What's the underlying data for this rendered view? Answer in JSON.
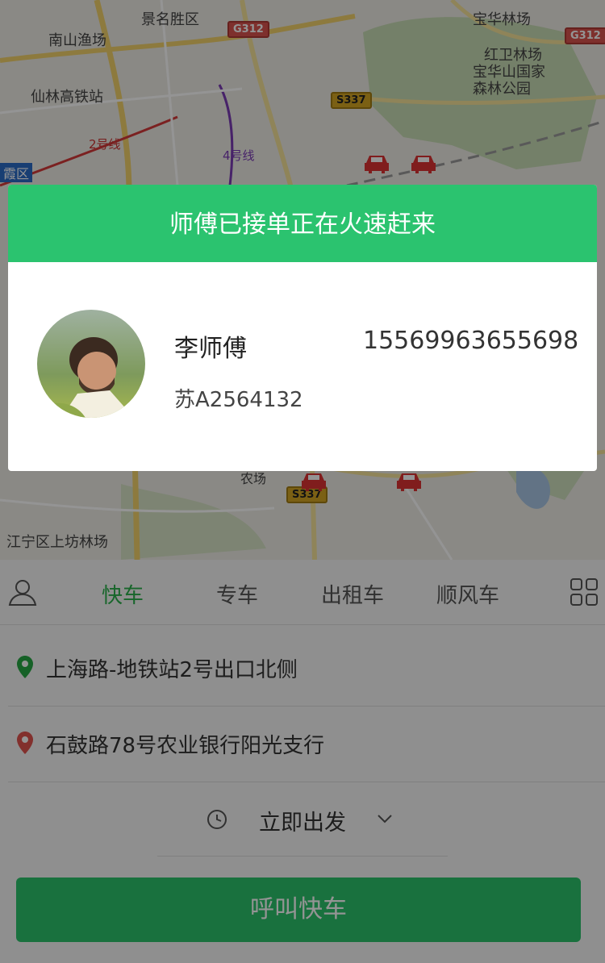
{
  "map": {
    "labels": [
      "南山渔场",
      "仙林高铁站",
      "景名胜区",
      "宝华林场",
      "红卫林场",
      "宝华山国家",
      "森林公园",
      "2号线",
      "4号线",
      "江宁区上坊林场",
      "农场",
      "霞区"
    ],
    "roads": [
      "G312",
      "G312",
      "S337",
      "S337"
    ]
  },
  "tabs": {
    "profile_icon": "person-icon",
    "items": [
      {
        "label": "快车",
        "active": true
      },
      {
        "label": "专车",
        "active": false
      },
      {
        "label": "出租车",
        "active": false
      },
      {
        "label": "顺风车",
        "active": false
      }
    ],
    "more_icon": "grid-icon"
  },
  "route": {
    "start": "上海路-地铁站2号出口北侧",
    "destination": "石鼓路78号农业银行阳光支行",
    "start_color": "#27a844",
    "destination_color": "#e0534e"
  },
  "departure": {
    "label": "立即出发"
  },
  "call_button": {
    "label": "呼叫快车"
  },
  "dialog": {
    "title": "师傅已接单正在火速赶来",
    "driver": {
      "name": "李师傅",
      "phone": "15569963655698",
      "plate": "苏A2564132"
    }
  },
  "colors": {
    "accent": "#2bc36f",
    "active_tab": "#2ab04a"
  }
}
